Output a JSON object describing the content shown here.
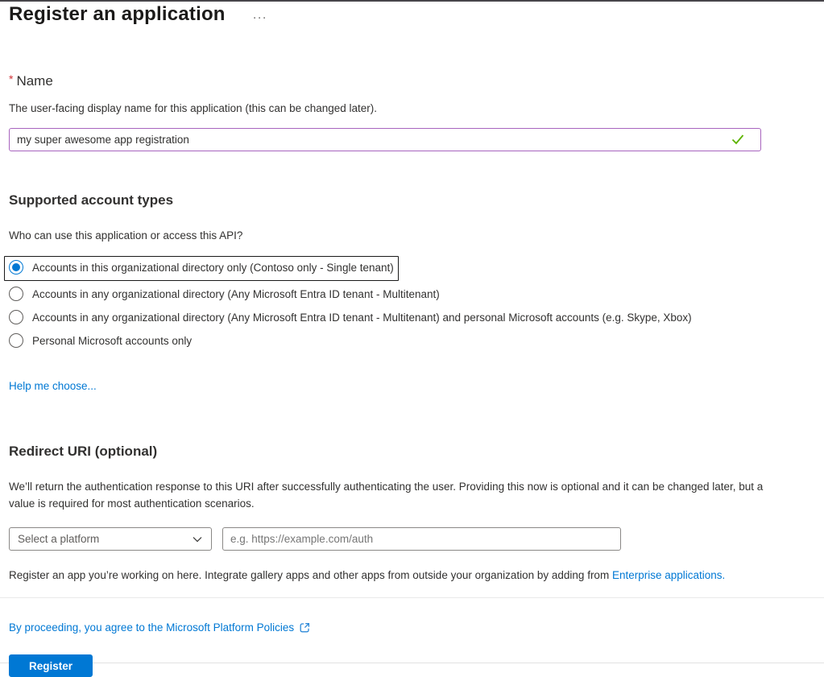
{
  "page": {
    "title": "Register an application",
    "more_options_glyph": "···"
  },
  "name_section": {
    "required_marker": "*",
    "label": "Name",
    "description": "The user-facing display name for this application (this can be changed later).",
    "input_value": "my super awesome app registration",
    "validation_icon": "checkmark-icon",
    "validation_state": "valid"
  },
  "account_types_section": {
    "heading": "Supported account types",
    "question": "Who can use this application or access this API?",
    "options": [
      {
        "label": "Accounts in this organizational directory only (Contoso only - Single tenant)",
        "selected": true,
        "focused": true
      },
      {
        "label": "Accounts in any organizational directory (Any Microsoft Entra ID tenant - Multitenant)",
        "selected": false,
        "focused": false
      },
      {
        "label": "Accounts in any organizational directory (Any Microsoft Entra ID tenant - Multitenant) and personal Microsoft accounts (e.g. Skype, Xbox)",
        "selected": false,
        "focused": false
      },
      {
        "label": "Personal Microsoft accounts only",
        "selected": false,
        "focused": false
      }
    ],
    "help_link_label": "Help me choose..."
  },
  "redirect_uri_section": {
    "heading": "Redirect URI (optional)",
    "description": "We’ll return the authentication response to this URI after successfully authenticating the user. Providing this now is optional and it can be changed later, but a value is required for most authentication scenarios.",
    "platform_select_value": "Select a platform",
    "platform_select_icon": "chevron-down-icon",
    "uri_placeholder": "e.g. https://example.com/auth"
  },
  "footer": {
    "note_text": "Register an app you’re working on here. Integrate gallery apps and other apps from outside your organization by adding from ",
    "note_link_label": "Enterprise applications.",
    "policy_link_label": "By proceeding, you agree to the Microsoft Platform Policies",
    "policy_link_icon": "external-link-icon",
    "register_button_label": "Register"
  },
  "colors": {
    "accent_blue": "#0078d4",
    "link_blue": "#0078d4",
    "valid_green": "#5db300",
    "name_input_border": "#a864be",
    "required_red": "#d13438",
    "text": "#323130",
    "divider": "#eaeaea"
  }
}
